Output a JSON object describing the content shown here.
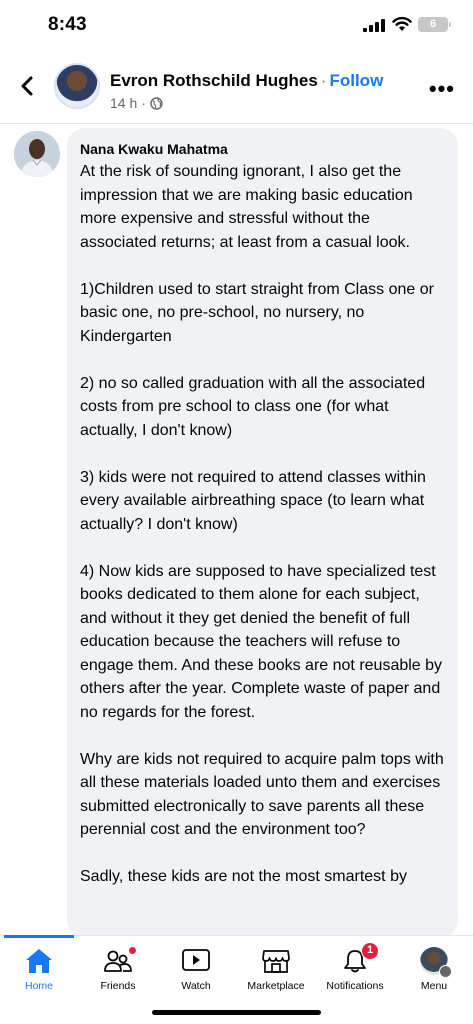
{
  "status_bar": {
    "time": "8:43",
    "battery": "6"
  },
  "post": {
    "author_name": "Evron Rothschild Hughes",
    "separator": "·",
    "follow_label": "Follow",
    "timestamp": "14 h",
    "meta_separator": "·"
  },
  "comment": {
    "name": "Nana Kwaku Mahatma",
    "paragraphs": [
      "At the risk of sounding ignorant,  I also get the impression that we are making basic education more expensive and stressful without the associated returns; at least from a casual look.",
      "1)Children used to start straight from Class one or basic one, no pre-school, no nursery, no Kindergarten",
      "2) no so called graduation with all the associated costs from pre school to class one (for what actually,  I don't know)",
      "3) kids were not required to attend classes within every available airbreathing  space (to learn what actually? I don't know)",
      "4) Now kids are supposed to have specialized test books dedicated to them alone for each subject, and without it they get denied the benefit of full education because the teachers will refuse to engage them. And these books are not reusable by others after the year. Complete waste of paper and no regards for the forest.",
      "Why are kids not required to acquire palm tops with all these materials loaded unto them and exercises submitted electronically to save parents all these perennial cost and the environment too?",
      "Sadly, these kids are not the most smartest by"
    ]
  },
  "tabs": [
    {
      "label": "Home",
      "icon": "home-icon",
      "active": true
    },
    {
      "label": "Friends",
      "icon": "friends-icon"
    },
    {
      "label": "Watch",
      "icon": "watch-icon"
    },
    {
      "label": "Marketplace",
      "icon": "marketplace-icon"
    },
    {
      "label": "Notifications",
      "icon": "bell-icon",
      "badge": "1"
    },
    {
      "label": "Menu",
      "icon": "menu-avatar"
    }
  ],
  "colors": {
    "accent": "#1877f2",
    "badge": "#e41e3f",
    "bubble": "#f0f2f5"
  }
}
